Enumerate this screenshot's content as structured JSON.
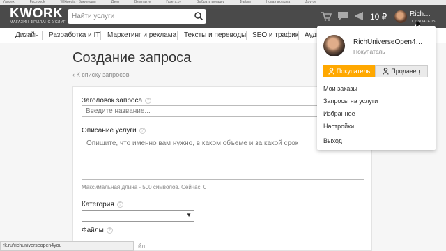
{
  "bookmarks": [
    "Yandex",
    "Facebook",
    "Wikipedia - Википедия",
    "Дзен",
    "Вконтакте",
    "Газета.ру",
    "Выбрать вкладку",
    "Файлы",
    "Новая вкладка",
    "Другое"
  ],
  "header": {
    "logo_main": "KWORK",
    "logo_sub": "МАГАЗИН ФРИЛАНС-УСЛУГ",
    "search_placeholder": "Найти услуги",
    "balance": "10 ₽",
    "user_short": "Rich…",
    "user_role": "ПОКУПАТЕЛЬ",
    "icons": [
      "cart-icon",
      "chat-icon",
      "megaphone-icon"
    ]
  },
  "categories": [
    "Дизайн",
    "Разработка и IT",
    "Маркетинг и реклама",
    "Тексты и переводы",
    "SEO и трафик",
    "Ауди"
  ],
  "page": {
    "title": "Создание запроса",
    "back_link": "‹ К списку запросов"
  },
  "form": {
    "title_label": "Заголовок запроса",
    "title_placeholder": "Введите название...",
    "desc_label": "Описание услуги",
    "desc_placeholder": "Опишите, что именно вам нужно, в каком объеме и за какой срок",
    "desc_hint": "Максимальная длина - 500 символов. Сейчас: 0",
    "category_label": "Категория",
    "files_label": "Файлы",
    "help_glyph": "?"
  },
  "dropdown": {
    "username": "RichUniverseOpen4…",
    "role": "Покупатель",
    "buyer_btn": "Покупатель",
    "seller_btn": "Продавец",
    "menu": [
      "Мои заказы",
      "Запросы на услуги",
      "Избранное",
      "Настройки"
    ],
    "logout": "Выход"
  },
  "statusbar": {
    "url": "rk.ru/richuniverseopen4you",
    "behind_text": "йл"
  },
  "colors": {
    "header_bg": "#4a4a4a",
    "accent": "#ffa800",
    "page_bg": "#f6f6f6"
  }
}
